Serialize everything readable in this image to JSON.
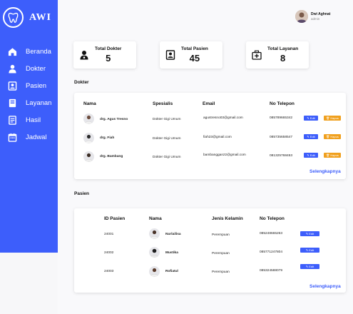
{
  "brand": {
    "name": "AWI"
  },
  "sidebar": {
    "items": [
      {
        "label": "Beranda",
        "icon": "home-icon"
      },
      {
        "label": "Dokter",
        "icon": "doctor-icon"
      },
      {
        "label": "Pasien",
        "icon": "patient-card-icon"
      },
      {
        "label": "Layanan",
        "icon": "book-icon"
      },
      {
        "label": "Hasil",
        "icon": "report-icon"
      },
      {
        "label": "Jadwal",
        "icon": "calendar-icon"
      }
    ]
  },
  "user": {
    "name": "Dwi Aghnat",
    "role": "admin"
  },
  "stats": [
    {
      "title": "Total Dokter",
      "value": "5"
    },
    {
      "title": "Total Pasien",
      "value": "45"
    },
    {
      "title": "Total Layanan",
      "value": "8"
    }
  ],
  "doctors": {
    "section_title": "Dokter",
    "headers": [
      "Nama",
      "Spesialis",
      "Email",
      "No Telepon"
    ],
    "rows": [
      {
        "name": "drg. Agus Tresno",
        "specialty": "Dokter Gigi Umum",
        "email": "agustresno03@gmail.com",
        "phone": "085789665342"
      },
      {
        "name": "drg. Fiah",
        "specialty": "Dokter Gigi Umum",
        "email": "fiah23@gmail.com",
        "phone": "085735658547"
      },
      {
        "name": "drg. Bambang",
        "specialty": "Dokter Gigi Umum",
        "email": "bambangganz2@gmail.com",
        "phone": "081325768453"
      }
    ],
    "edit_label": "Edit",
    "delete_label": "Hapus",
    "more_label": "Selengkapnya"
  },
  "patients": {
    "section_title": "Pasien",
    "headers": [
      "ID Pasien",
      "Nama",
      "Jenis Kelamin",
      "No Telepon"
    ],
    "rows": [
      {
        "id": "24001",
        "name": "Nurlailisa",
        "gender": "Perempuan",
        "phone": "085248665263"
      },
      {
        "id": "24002",
        "name": "Mustika",
        "gender": "Perempuan",
        "phone": "085771247804"
      },
      {
        "id": "24003",
        "name": "Rofiatul",
        "gender": "Perempuan",
        "phone": "085324588079"
      }
    ],
    "edit_label": "Edit",
    "more_label": "Selengkapnya"
  },
  "colors": {
    "accent": "#3d5efb",
    "warning": "#f0a01e",
    "background": "#f9f9fb"
  }
}
